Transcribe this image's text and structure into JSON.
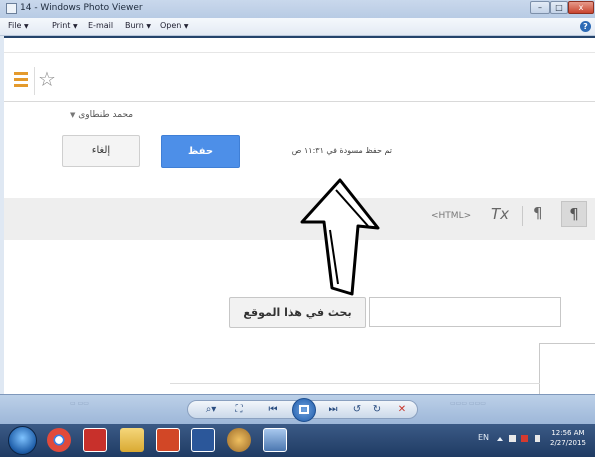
{
  "window": {
    "title": "14 - Windows Photo Viewer",
    "min_label": "–",
    "max_label": "□",
    "close_label": "x"
  },
  "menu": {
    "items": [
      "File",
      "Print",
      "E-mail",
      "Burn",
      "Open"
    ],
    "caret": "▼",
    "help": "?"
  },
  "page": {
    "user_name": "محمد طنطاوى",
    "user_caret": "▼",
    "cancel_label": "إلغاء",
    "save_label": "حفظ",
    "draft_status": "تم حفظ مسودة في ١١:٣١ ص",
    "html_tag": "<HTML>",
    "clear_format_glyph": "Tx",
    "ltr_glyph": "¶",
    "rtl_glyph": "¶",
    "search_button_label": "بحث في هذا الموقع"
  },
  "viewer_controls": {
    "zoom": "⌕▾",
    "fit": "⛶",
    "prev": "⏮",
    "next": "⏭",
    "rotate_ccw": "↺",
    "rotate_cw": "↻",
    "delete": "✕"
  },
  "taskbar": {
    "language": "EN",
    "time": "12:56 AM",
    "date": "2/27/2015",
    "apps": [
      "chrome",
      "pdf-reader",
      "file-explorer",
      "powerpoint",
      "word",
      "paint",
      "photo-viewer"
    ]
  },
  "colors": {
    "save_button": "#4d8fe8",
    "hamburger": "#e49a2c",
    "taskbar": "#1f3b63"
  }
}
